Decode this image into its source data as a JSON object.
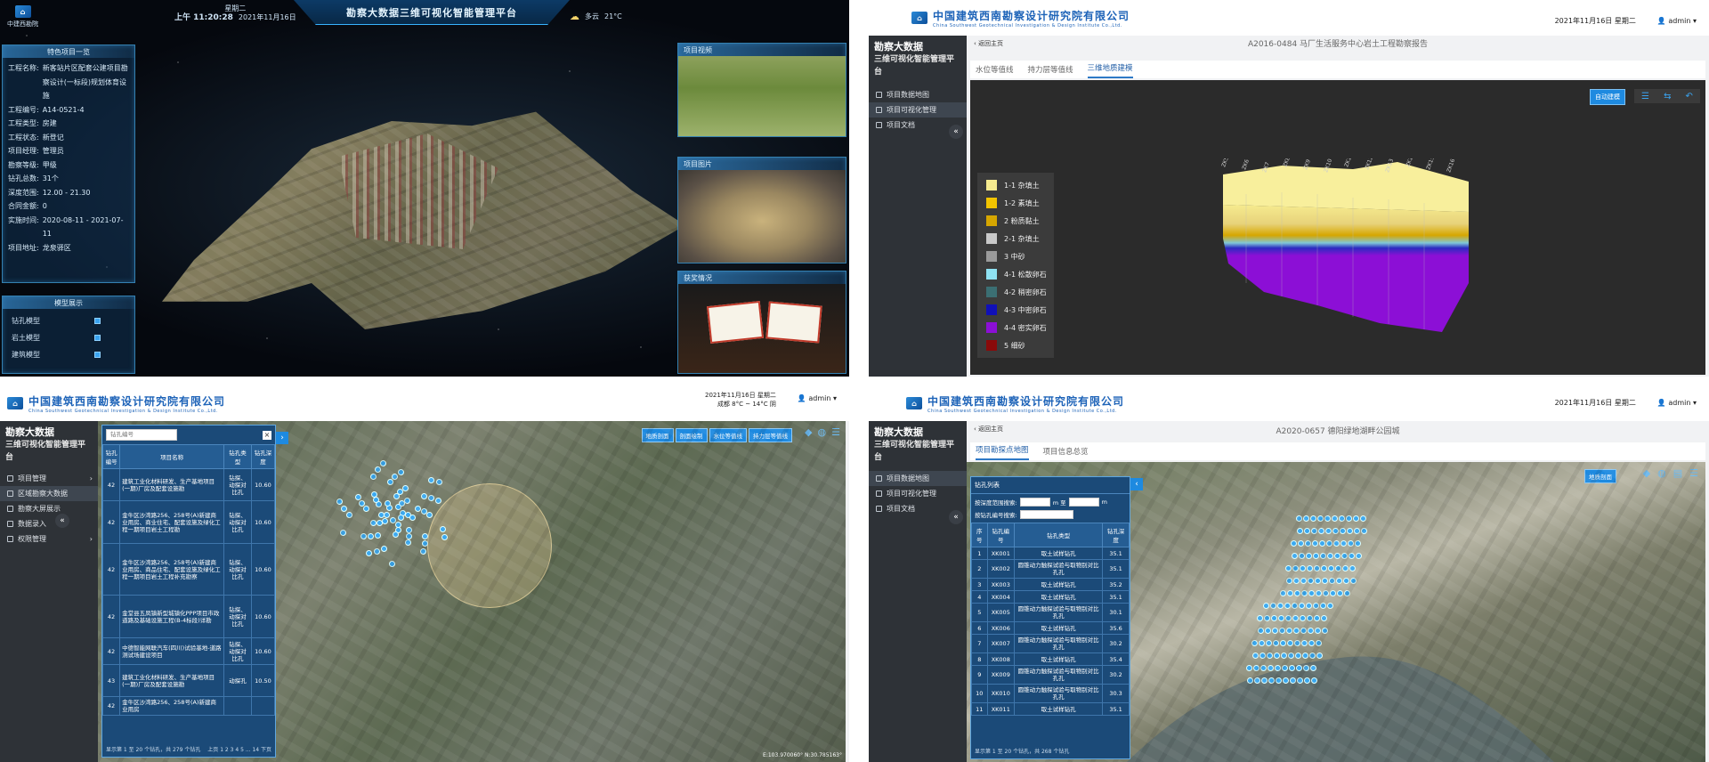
{
  "q1": {
    "logo_text": "中建西勘院",
    "title": "勘察大数据三维可视化智能管理平台",
    "weekday": "星期二",
    "time": "上午 11:20:28",
    "date": "2021年11月16日",
    "weather": "多云",
    "temp": "21°C",
    "info_panel_title": "特色项目一览",
    "info": [
      {
        "k": "工程名称:",
        "v": "新客站片区配套公建项目勘察设计(一标段)规划体育设施"
      },
      {
        "k": "工程编号:",
        "v": "A14-0521-4"
      },
      {
        "k": "工程类型:",
        "v": "房建"
      },
      {
        "k": "工程状态:",
        "v": "新登记"
      },
      {
        "k": "项目经理:",
        "v": "管理员"
      },
      {
        "k": "勘察等级:",
        "v": "甲级"
      },
      {
        "k": "钻孔总数:",
        "v": "31个"
      },
      {
        "k": "深度范围:",
        "v": "12.00 - 21.30"
      },
      {
        "k": "合同金额:",
        "v": "0"
      },
      {
        "k": "实施时间:",
        "v": "2020-08-11 - 2021-07-11"
      },
      {
        "k": "项目地址:",
        "v": "龙泉驿区"
      }
    ],
    "model_panel_title": "模型展示",
    "models": [
      "钻孔模型",
      "岩土模型",
      "建筑模型"
    ],
    "video_title": "项目视频",
    "photo_title": "项目图片",
    "award_title": "获奖情况"
  },
  "q2": {
    "company_cn": "中国建筑西南勘察设计研究院有限公司",
    "company_en": "China Southwest Geotechnical Investigation & Design Institute Co.,Ltd.",
    "date": "2021年11月16日 星期二",
    "user": "admin",
    "brand_a": "勘察大数据",
    "brand_b": "三维可视化智能管理平台",
    "menu": [
      "项目数据地图",
      "项目可视化管理",
      "项目文档"
    ],
    "crumb": "返回主页",
    "report": "A2016-0484 马厂生活服务中心岩土工程勘察报告",
    "tabs": [
      "水位等值线",
      "持力层等值线",
      "三维地质建模"
    ],
    "auto_btn": "自动建模",
    "legend": [
      {
        "label": "1-1 杂填土",
        "color": "#f6eb8f"
      },
      {
        "label": "1-2 素填土",
        "color": "#f2c400"
      },
      {
        "label": "2 粉质黏土",
        "color": "#d6a600"
      },
      {
        "label": "2-1 杂填土",
        "color": "#c9c9c9"
      },
      {
        "label": "3 中砂",
        "color": "#9a9a9a"
      },
      {
        "label": "4-1 松散卵石",
        "color": "#8fe2f2"
      },
      {
        "label": "4-2 稍密卵石",
        "color": "#3b6f73"
      },
      {
        "label": "4-3 中密卵石",
        "color": "#1010b8"
      },
      {
        "label": "4-4 密实卵石",
        "color": "#8c0fd6"
      },
      {
        "label": "5 细砂",
        "color": "#8a0a0a"
      }
    ],
    "bore_labels": [
      "ZK5",
      "ZK6",
      "ZK7",
      "ZK8",
      "ZK9",
      "ZK10",
      "ZK11",
      "ZK12",
      "ZK13",
      "ZK14",
      "ZK15",
      "ZK16"
    ]
  },
  "q3": {
    "company_cn": "中国建筑西南勘察设计研究院有限公司",
    "company_en": "China Southwest Geotechnical Investigation & Design Institute Co.,Ltd.",
    "date": "2021年11月16日 星期二",
    "weather": "成都 8°C ~ 14°C 阴",
    "user": "admin",
    "brand_a": "勘察大数据",
    "brand_b": "三维可视化智能管理平台",
    "menu": [
      "项目管理",
      "区域勘察大数据",
      "勘察大屏展示",
      "数据录入",
      "权限管理"
    ],
    "search_placeholder": "钻孔编号",
    "columns": [
      "钻孔编号",
      "项目名称",
      "钻孔类型",
      "钻孔深度"
    ],
    "rows": [
      [
        "42",
        "建筑工业化材料研发、生产基地项目(一期)厂房及配套设施勘",
        "钻探、动探对比孔",
        "10.60"
      ],
      [
        "42",
        "金牛区沙湾路256、258号(A)新建商业用房、商业住宅、配套设施及绿化工程一期项目岩土工程勘",
        "钻探、动探对比孔",
        "10.60"
      ],
      [
        "42",
        "金牛区沙湾路256、258号(A)新建商业用房、商品住宅、配套设施及绿化工程一期项目岩土工程补充勘察",
        "钻探、动探对比孔",
        "10.60"
      ],
      [
        "42",
        "金堂县五凤镇新型城镇化PPP项目市政道路及基础设施工程(B-4标段)详勘",
        "钻探、动探对比孔",
        "10.60"
      ],
      [
        "42",
        "中德智能网联汽车(四川)试验基地-道路测试场建设项目",
        "钻探、动探对比孔",
        "10.60"
      ],
      [
        "43",
        "建筑工业化材料研发、生产基地项目(一期)厂房及配套设施勘",
        "动探孔",
        "10.50"
      ],
      [
        "42",
        "金牛区沙湾路256、258号(A)新建商业用房",
        "",
        ""
      ]
    ],
    "footer": "显示第 1 至 20 个钻孔，共 279 个钻孔",
    "pager": "上页 1 2 3 4 5 ... 14 下页",
    "map_btns": [
      "地质剖面",
      "剖面绘制",
      "水位等值线",
      "持力层等值线"
    ],
    "coords": "E:103.970060° N:30.785163°"
  },
  "q4": {
    "company_cn": "中国建筑西南勘察设计研究院有限公司",
    "company_en": "China Southwest Geotechnical Investigation & Design Institute Co.,Ltd.",
    "date": "2021年11月16日 星期二",
    "user": "admin",
    "brand_a": "勘察大数据",
    "brand_b": "三维可视化智能管理平台",
    "menu": [
      "项目数据地图",
      "项目可视化管理",
      "项目文档"
    ],
    "crumb": "返回主页",
    "report": "A2020-0657 德阳绿地湖畔公园城",
    "tabs": [
      "项目勘探点地图",
      "项目信息总览"
    ],
    "panel_title": "钻孔列表",
    "depth_label": "按深度范围搜索:",
    "depth_to": "m 至",
    "depth_unit": "m",
    "code_label": "按钻孔编号搜索:",
    "columns": [
      "序号",
      "钻孔编号",
      "钻孔类型",
      "钻孔深度"
    ],
    "rows": [
      [
        "1",
        "XK001",
        "取土试样钻孔",
        "35.1"
      ],
      [
        "2",
        "XK002",
        "圆锥动力触探试验与取物别对比孔孔",
        "35.1"
      ],
      [
        "3",
        "XK003",
        "取土试样钻孔",
        "35.2"
      ],
      [
        "4",
        "XK004",
        "取土试样钻孔",
        "35.1"
      ],
      [
        "5",
        "XK005",
        "圆锥动力触探试验与取物别对比孔孔",
        "30.1"
      ],
      [
        "6",
        "XK006",
        "取土试样钻孔",
        "35.6"
      ],
      [
        "7",
        "XK007",
        "圆锥动力触探试验与取物别对比孔孔",
        "30.2"
      ],
      [
        "8",
        "XK008",
        "取土试样钻孔",
        "35.4"
      ],
      [
        "9",
        "XK009",
        "圆锥动力触探试验与取物别对比孔孔",
        "30.2"
      ],
      [
        "10",
        "XK010",
        "圆锥动力触探试验与取物别对比孔孔",
        "30.3"
      ],
      [
        "11",
        "XK011",
        "取土试样钻孔",
        "35.1"
      ]
    ],
    "footer": "显示第 1 至 20 个钻孔，共 268 个钻孔",
    "map_btn": "地质剖面"
  }
}
